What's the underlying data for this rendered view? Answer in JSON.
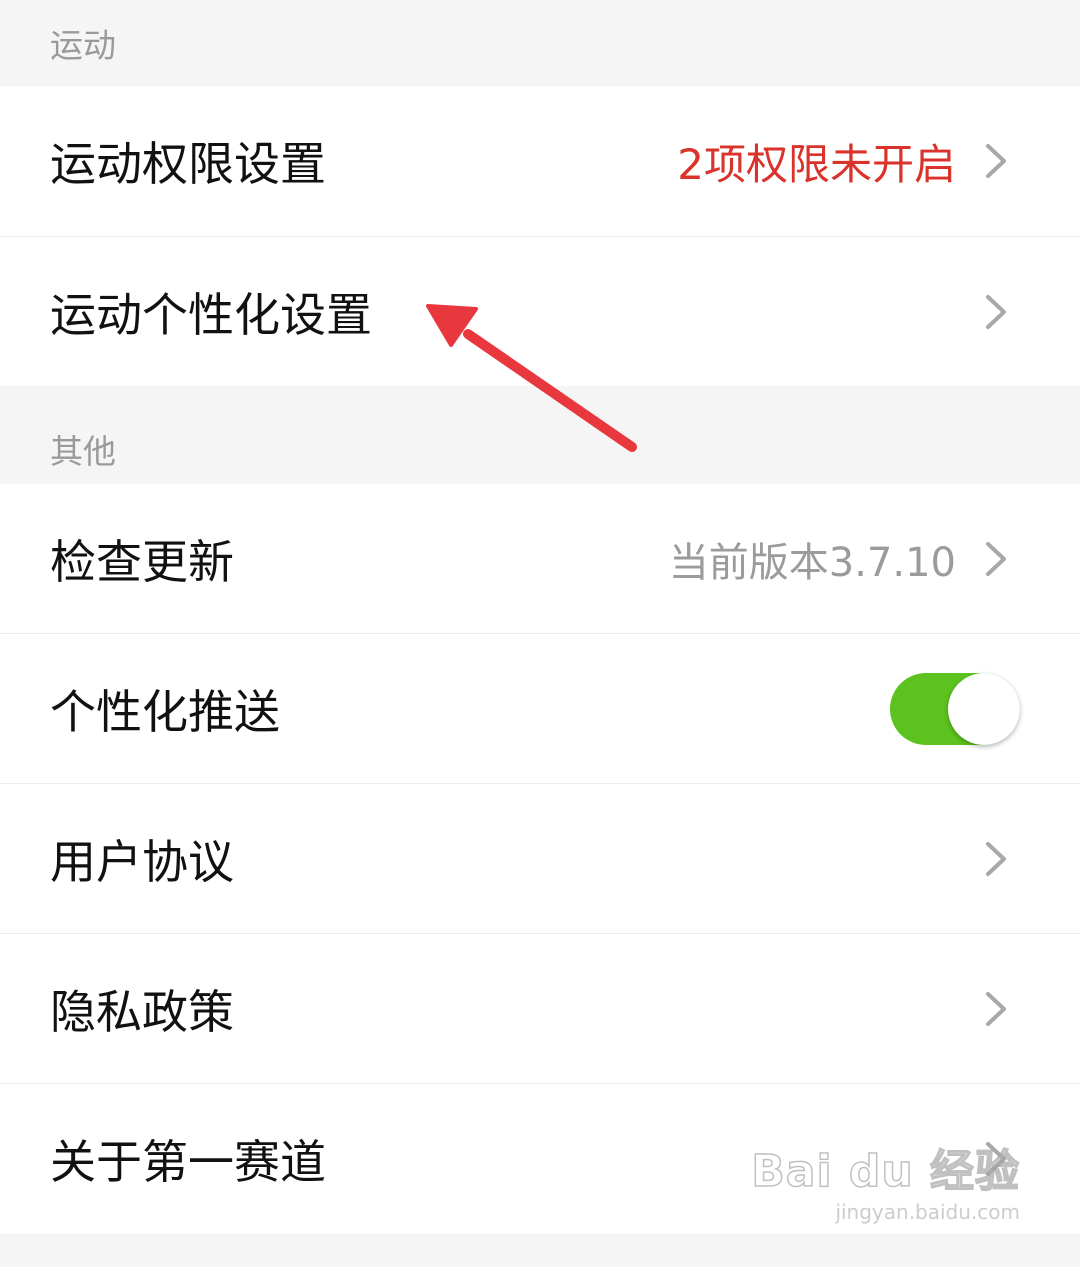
{
  "sections": {
    "sport": {
      "title": "运动",
      "permission": {
        "label": "运动权限设置",
        "value": "2项权限未开启"
      },
      "personalization": {
        "label": "运动个性化设置"
      }
    },
    "other": {
      "title": "其他",
      "update": {
        "label": "检查更新",
        "value": "当前版本3.7.10"
      },
      "push": {
        "label": "个性化推送",
        "enabled": true
      },
      "agreement": {
        "label": "用户协议"
      },
      "privacy": {
        "label": "隐私政策"
      },
      "about": {
        "label": "关于第一赛道"
      }
    }
  },
  "watermark": {
    "logo": "Bai du 经验",
    "url": "jingyan.baidu.com"
  },
  "colors": {
    "warning": "#d9332b",
    "toggle_on": "#5cc21f",
    "annotation_arrow": "#e8383d",
    "background": "#f5f5f5"
  },
  "icons": {
    "chevron": "chevron-right-icon",
    "arrow": "annotation-arrow-icon"
  }
}
